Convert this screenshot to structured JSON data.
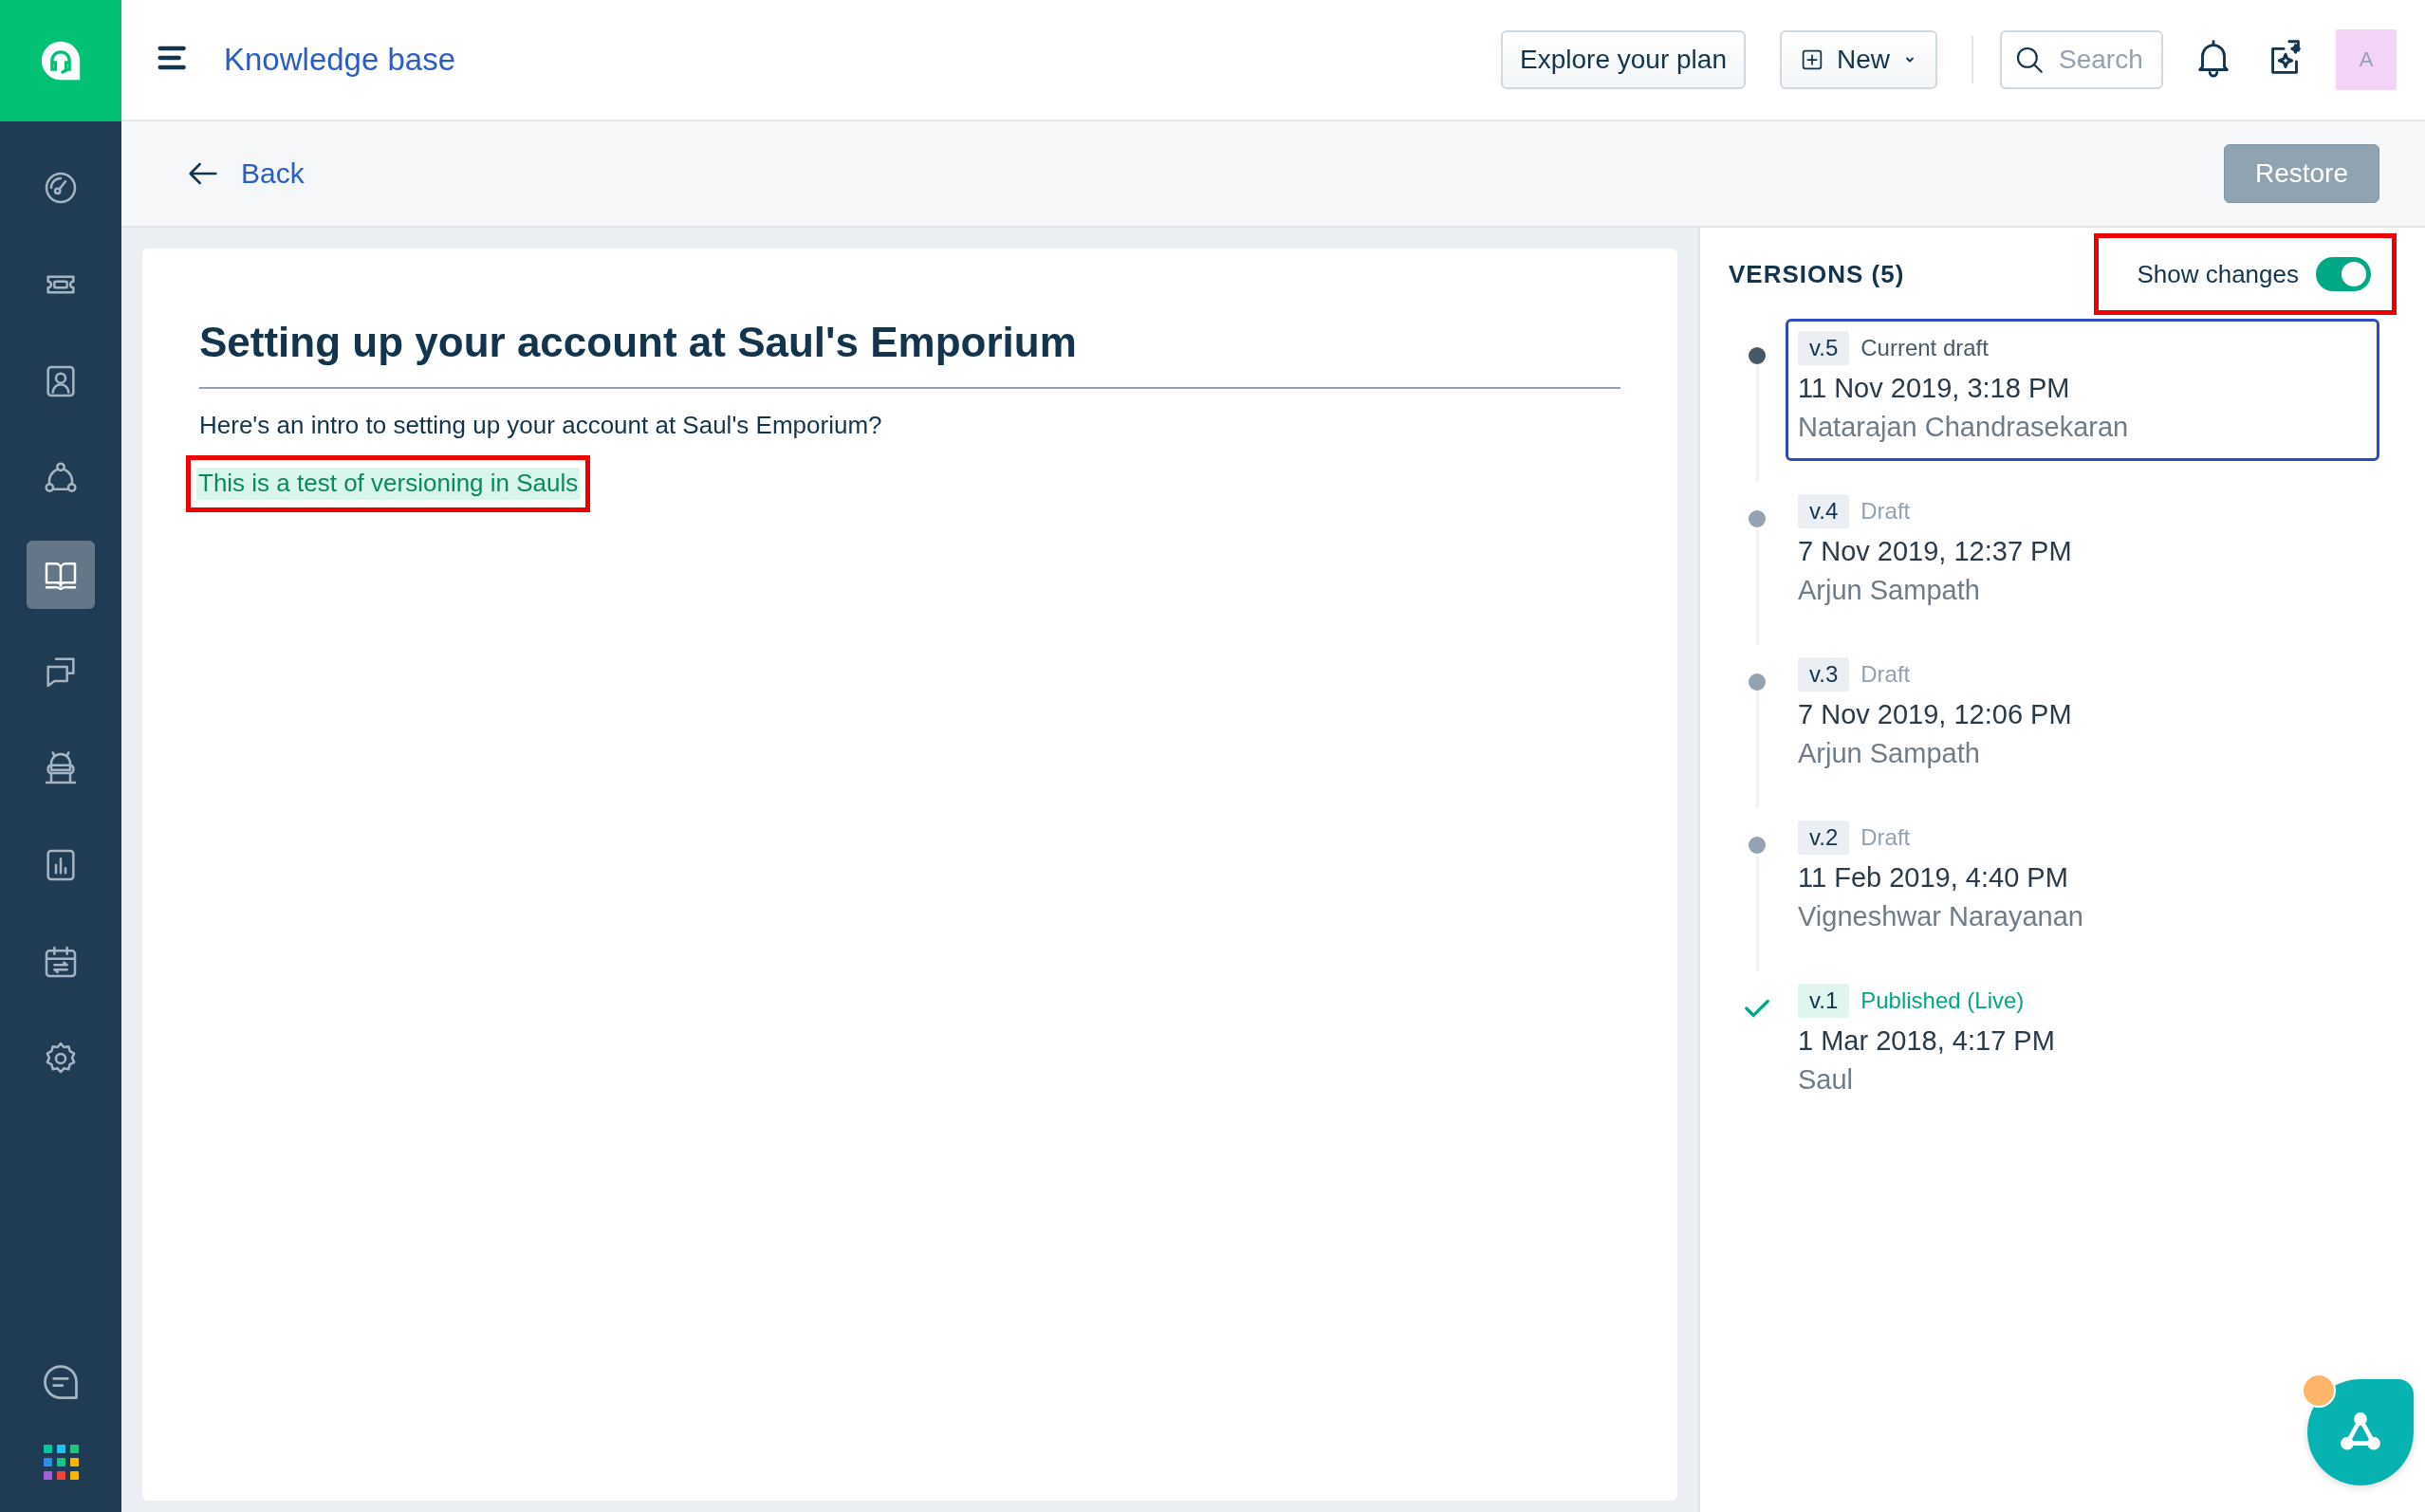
{
  "sidebar": {
    "nav": [
      {
        "kind": "dashboard",
        "selected": false
      },
      {
        "kind": "tickets",
        "selected": false
      },
      {
        "kind": "contacts",
        "selected": false
      },
      {
        "kind": "groups",
        "selected": false
      },
      {
        "kind": "knowledge",
        "selected": true
      },
      {
        "kind": "conversations",
        "selected": false
      },
      {
        "kind": "assets",
        "selected": false
      },
      {
        "kind": "reports",
        "selected": false
      },
      {
        "kind": "calendar",
        "selected": false
      },
      {
        "kind": "settings",
        "selected": false
      }
    ],
    "footer": [
      {
        "kind": "chat"
      },
      {
        "kind": "apps"
      }
    ]
  },
  "header": {
    "title": "Knowledge base",
    "plan_button": "Explore your plan",
    "new_button": "New",
    "search": {
      "placeholder": "Search"
    },
    "avatar": "A"
  },
  "toolbar": {
    "back": "Back",
    "restore": {
      "label": "Restore",
      "disabled": true
    }
  },
  "article": {
    "title": "Setting up your account at Saul's Emporium",
    "paragraphs": [
      {
        "text": "Here's an intro to setting up your account at Saul's Emporium?",
        "added": false,
        "annotated": false
      },
      {
        "text": "This is a test of versioning in Sauls",
        "added": true,
        "annotated": true
      }
    ]
  },
  "versions": {
    "title": "VERSIONS (5)",
    "show_changes": {
      "label": "Show changes",
      "on": true,
      "annotated": true
    },
    "items": [
      {
        "kind": "current",
        "version": "v.5",
        "status": "Current draft",
        "date": "11 Nov 2019, 3:18 PM",
        "author": "Natarajan Chandrasekaran",
        "selected": true
      },
      {
        "kind": "draft",
        "version": "v.4",
        "status": "Draft",
        "date": "7 Nov 2019, 12:37 PM",
        "author": "Arjun Sampath",
        "selected": false
      },
      {
        "kind": "draft",
        "version": "v.3",
        "status": "Draft",
        "date": "7 Nov 2019, 12:06 PM",
        "author": "Arjun Sampath",
        "selected": false
      },
      {
        "kind": "draft",
        "version": "v.2",
        "status": "Draft",
        "date": "11 Feb 2019, 4:40 PM",
        "author": "Vigneshwar Narayanan",
        "selected": false
      },
      {
        "kind": "published",
        "version": "v.1",
        "status": "Published (Live)",
        "date": "1 Mar 2018, 4:17 PM",
        "author": "Saul",
        "selected": false
      }
    ]
  },
  "assistant": {
    "notification": true
  }
}
